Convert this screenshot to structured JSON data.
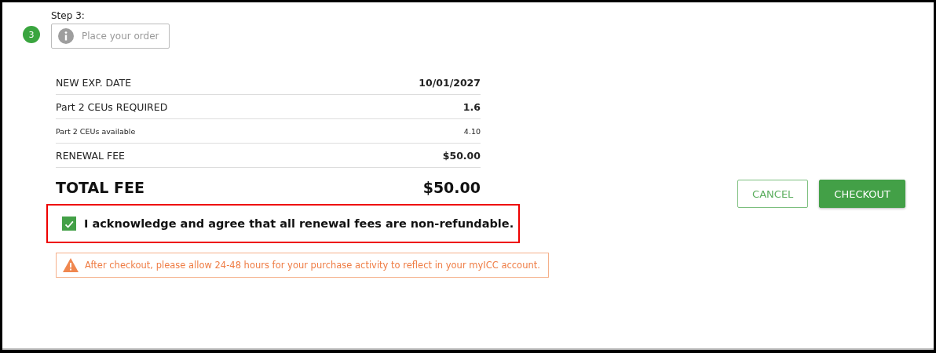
{
  "step": {
    "badge": "3",
    "title": "Step 3:",
    "info": "Place your order"
  },
  "summary": [
    {
      "kind": "normal",
      "label": "NEW EXP. DATE",
      "value": "10/01/2027"
    },
    {
      "kind": "normal",
      "label": "Part 2 CEUs REQUIRED",
      "value": "1.6"
    },
    {
      "kind": "small",
      "label": "Part 2 CEUs available",
      "value": "4.10"
    },
    {
      "kind": "normal",
      "label": "RENEWAL FEE",
      "value": "$50.00"
    },
    {
      "kind": "total",
      "label": "TOTAL FEE",
      "value": "$50.00"
    }
  ],
  "agreement": {
    "checked": true,
    "highlighted": true,
    "text": "I acknowledge and agree that all renewal fees are non-refundable."
  },
  "warning": "After checkout, please allow 24-48 hours for your purchase activity to reflect in your myICC account.",
  "buttons": [
    {
      "kind": "secondary",
      "label": "CANCEL"
    },
    {
      "kind": "primary",
      "label": "CHECKOUT"
    }
  ]
}
